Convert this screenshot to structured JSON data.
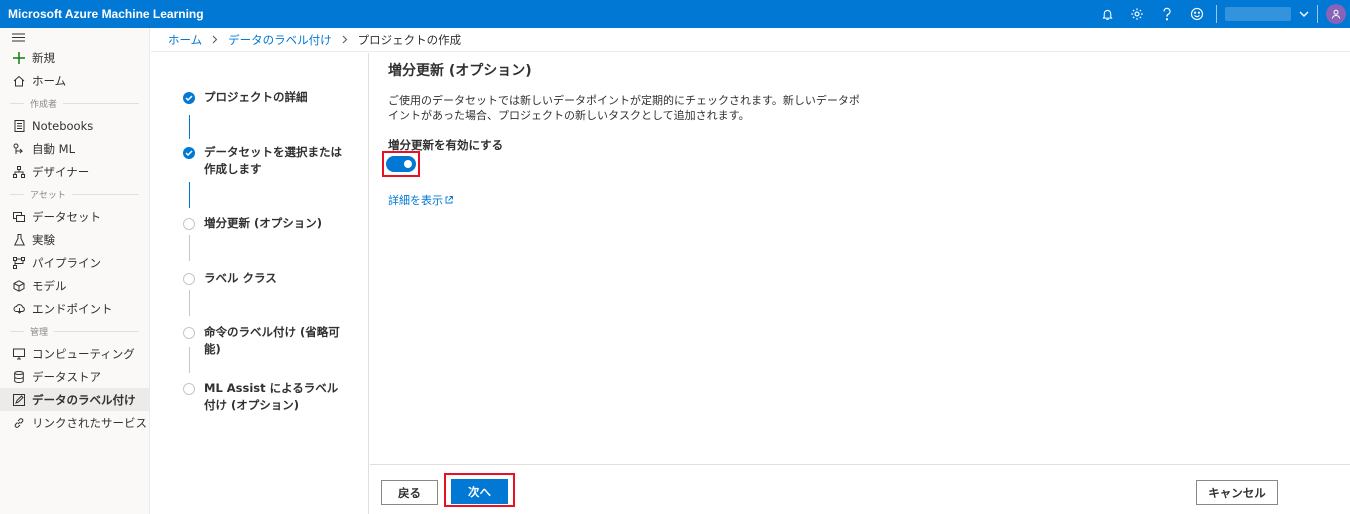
{
  "app": {
    "title": "Microsoft Azure Machine Learning"
  },
  "topbar": {
    "icons": [
      "bell-icon",
      "gear-icon",
      "help-icon",
      "smiley-icon"
    ],
    "avatar_color": "#8764b8",
    "accent": "#0078d4"
  },
  "sidebar": {
    "new_label": "新規",
    "home_label": "ホーム",
    "section_author": "作成者",
    "notebooks_label": "Notebooks",
    "automl_label": "自動 ML",
    "designer_label": "デザイナー",
    "section_assets": "アセット",
    "datasets_label": "データセット",
    "experiments_label": "実験",
    "pipelines_label": "パイプライン",
    "models_label": "モデル",
    "endpoints_label": "エンドポイント",
    "section_manage": "管理",
    "compute_label": "コンピューティング",
    "datastores_label": "データストア",
    "labeling_label": "データのラベル付け",
    "linked_label": "リンクされたサービス"
  },
  "breadcrumb": {
    "home": "ホーム",
    "labeling": "データのラベル付け",
    "current": "プロジェクトの作成"
  },
  "steps": [
    {
      "label": "プロジェクトの詳細",
      "status": "done"
    },
    {
      "label": "データセットを選択または作成します",
      "status": "done"
    },
    {
      "label": "増分更新 (オプション)",
      "status": "todo"
    },
    {
      "label": "ラベル クラス",
      "status": "todo"
    },
    {
      "label": "命令のラベル付け (省略可能)",
      "status": "todo"
    },
    {
      "label": "ML Assist によるラベル付け (オプション)",
      "status": "todo"
    }
  ],
  "content": {
    "title": "増分更新 (オプション)",
    "description": "ご使用のデータセットでは新しいデータポイントが定期的にチェックされます。新しいデータポイントがあった場合、プロジェクトの新しいタスクとして追加されます。",
    "toggle_label": "増分更新を有効にする",
    "toggle_on": true,
    "link_text": "詳細を表示"
  },
  "footer": {
    "back_label": "戻る",
    "next_label": "次へ",
    "cancel_label": "キャンセル"
  }
}
